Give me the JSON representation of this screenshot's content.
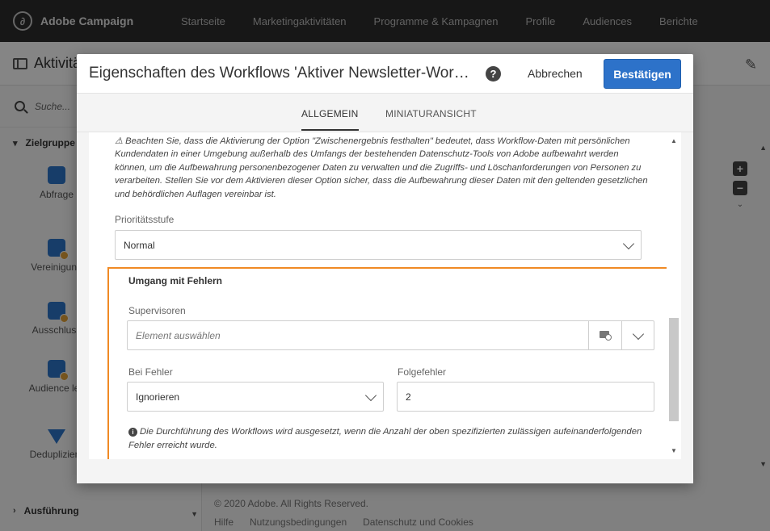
{
  "topbar": {
    "app_name": "Adobe Campaign",
    "nav": [
      "Startseite",
      "Marketingaktivitäten",
      "Programme & Kampagnen",
      "Profile",
      "Audiences",
      "Berichte"
    ]
  },
  "page": {
    "title": "Aktivitä",
    "search_placeholder": "Suche...",
    "section_targeting": "Zielgruppe",
    "tools": [
      "Abfrage",
      "Vereinigung",
      "Ausschluss",
      "Audience les",
      "Deduplizieru"
    ],
    "section_execution": "Ausführung",
    "footer_copyright": "© 2020 Adobe. All Rights Reserved.",
    "footer_links": [
      "Hilfe",
      "Nutzungsbedingungen",
      "Datenschutz und Cookies"
    ]
  },
  "modal": {
    "title": "Eigenschaften des Workflows 'Aktiver Newsletter-Workflow...",
    "help": "?",
    "cancel_label": "Abbrechen",
    "confirm_label": "Bestätigen",
    "tabs": [
      "ALLGEMEIN",
      "MINIATURANSICHT"
    ],
    "warning_text": "⚠ Beachten Sie, dass die Aktivierung der Option \"Zwischenergebnis festhalten\" bedeutet, dass Workflow-Daten mit persönlichen Kundendaten in einer Umgebung außerhalb des Umfangs der bestehenden Datenschutz-Tools von Adobe aufbewahrt werden können, um die Aufbewahrung personenbezogener Daten zu verwalten und die Zugriffs- und Löschanforderungen von Personen zu verarbeiten. Stellen Sie vor dem Aktivieren dieser Option sicher, dass die Aufbewahrung dieser Daten mit den geltenden gesetzlichen und behördlichen Auflagen vereinbar ist.",
    "priority": {
      "label": "Prioritätsstufe",
      "value": "Normal"
    },
    "error_handling": {
      "title": "Umgang mit Fehlern",
      "supervisors_label": "Supervisoren",
      "supervisors_placeholder": "Element auswählen",
      "on_error_label": "Bei Fehler",
      "on_error_value": "Ignorieren",
      "consecutive_label": "Folgefehler",
      "consecutive_value": "2",
      "info_text": "Die Durchführung des Workflows wird ausgesetzt, wenn die Anzahl der oben spezifizierten zulässigen aufeinanderfolgenden Fehler erreicht wurde."
    }
  },
  "colors": {
    "accent": "#2d72c9",
    "highlight": "#f08a24",
    "topbar": "#2c2c2c"
  }
}
